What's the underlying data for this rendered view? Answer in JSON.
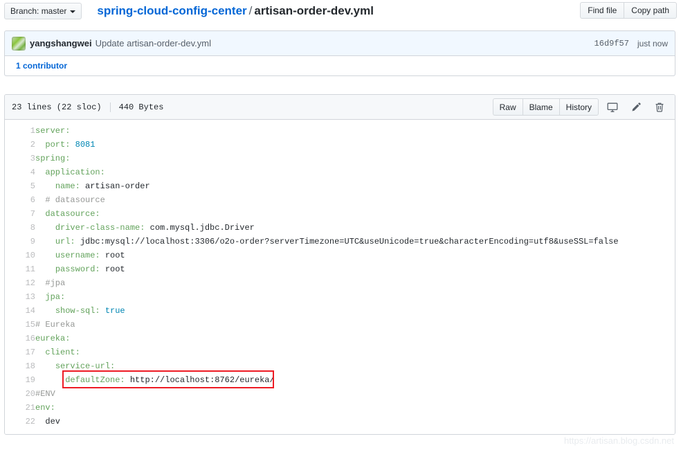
{
  "topbar": {
    "branch_label": "Branch: master",
    "branch_caret_icon": "chevron-down-icon",
    "repo_name": "spring-cloud-config-center",
    "path_separator": "/",
    "file_name": "artisan-order-dev.yml",
    "find_file_label": "Find file",
    "copy_path_label": "Copy path"
  },
  "commit": {
    "author": "yangshangwei",
    "message": "Update artisan-order-dev.yml",
    "sha": "16d9f57",
    "time": "just now",
    "contributors_label": "1 contributor"
  },
  "file": {
    "lines_label": "23 lines (22 sloc)",
    "size_label": "440 Bytes",
    "raw_label": "Raw",
    "blame_label": "Blame",
    "history_label": "History",
    "desktop_icon": "desktop-icon",
    "edit_icon": "pencil-icon",
    "delete_icon": "trash-icon"
  },
  "code": {
    "language": "yaml",
    "lines": [
      {
        "n": 1,
        "indent": 0,
        "tokens": [
          {
            "t": "server:",
            "c": "k"
          }
        ]
      },
      {
        "n": 2,
        "indent": 1,
        "tokens": [
          {
            "t": "port: ",
            "c": "k"
          },
          {
            "t": "8081",
            "c": "num"
          }
        ]
      },
      {
        "n": 3,
        "indent": 0,
        "tokens": [
          {
            "t": "spring:",
            "c": "k"
          }
        ]
      },
      {
        "n": 4,
        "indent": 1,
        "tokens": [
          {
            "t": "application:",
            "c": "k"
          }
        ]
      },
      {
        "n": 5,
        "indent": 2,
        "tokens": [
          {
            "t": "name: ",
            "c": "k"
          },
          {
            "t": "artisan-order",
            "c": "v"
          }
        ]
      },
      {
        "n": 6,
        "indent": 1,
        "tokens": [
          {
            "t": "# datasource",
            "c": "cm"
          }
        ]
      },
      {
        "n": 7,
        "indent": 1,
        "tokens": [
          {
            "t": "datasource:",
            "c": "k"
          }
        ]
      },
      {
        "n": 8,
        "indent": 2,
        "tokens": [
          {
            "t": "driver-class-name: ",
            "c": "k"
          },
          {
            "t": "com.mysql.jdbc.Driver",
            "c": "v"
          }
        ]
      },
      {
        "n": 9,
        "indent": 2,
        "tokens": [
          {
            "t": "url: ",
            "c": "k"
          },
          {
            "t": "jdbc:mysql://localhost:3306/o2o-order?serverTimezone=UTC&useUnicode=true&characterEncoding=utf8&useSSL=false",
            "c": "v"
          }
        ]
      },
      {
        "n": 10,
        "indent": 2,
        "tokens": [
          {
            "t": "username: ",
            "c": "k"
          },
          {
            "t": "root",
            "c": "v"
          }
        ]
      },
      {
        "n": 11,
        "indent": 2,
        "tokens": [
          {
            "t": "password: ",
            "c": "k"
          },
          {
            "t": "root",
            "c": "v"
          }
        ]
      },
      {
        "n": 12,
        "indent": 1,
        "tokens": [
          {
            "t": "#jpa",
            "c": "cm"
          }
        ]
      },
      {
        "n": 13,
        "indent": 1,
        "tokens": [
          {
            "t": "jpa:",
            "c": "k"
          }
        ]
      },
      {
        "n": 14,
        "indent": 2,
        "tokens": [
          {
            "t": "show-sql: ",
            "c": "k"
          },
          {
            "t": "true",
            "c": "num"
          }
        ]
      },
      {
        "n": 15,
        "indent": 0,
        "tokens": [
          {
            "t": "# Eureka",
            "c": "cm"
          }
        ]
      },
      {
        "n": 16,
        "indent": 0,
        "tokens": [
          {
            "t": "eureka:",
            "c": "k"
          }
        ]
      },
      {
        "n": 17,
        "indent": 1,
        "tokens": [
          {
            "t": "client:",
            "c": "k"
          }
        ]
      },
      {
        "n": 18,
        "indent": 2,
        "tokens": [
          {
            "t": "service-url:",
            "c": "k"
          }
        ]
      },
      {
        "n": 19,
        "indent": 3,
        "tokens": [
          {
            "t": "defaultZone: ",
            "c": "k"
          },
          {
            "t": "http://localhost:8762/eureka/",
            "c": "v"
          }
        ]
      },
      {
        "n": 20,
        "indent": 0,
        "tokens": [
          {
            "t": "#ENV",
            "c": "cm"
          }
        ]
      },
      {
        "n": 21,
        "indent": 0,
        "tokens": [
          {
            "t": "env:",
            "c": "k"
          }
        ]
      },
      {
        "n": 22,
        "indent": 1,
        "tokens": [
          {
            "t": "dev",
            "c": "v"
          }
        ]
      }
    ]
  },
  "annotation": {
    "color": "#ee1c25",
    "target_line": 19
  },
  "watermark": {
    "text": "https://artisan.blog.csdn.net"
  }
}
